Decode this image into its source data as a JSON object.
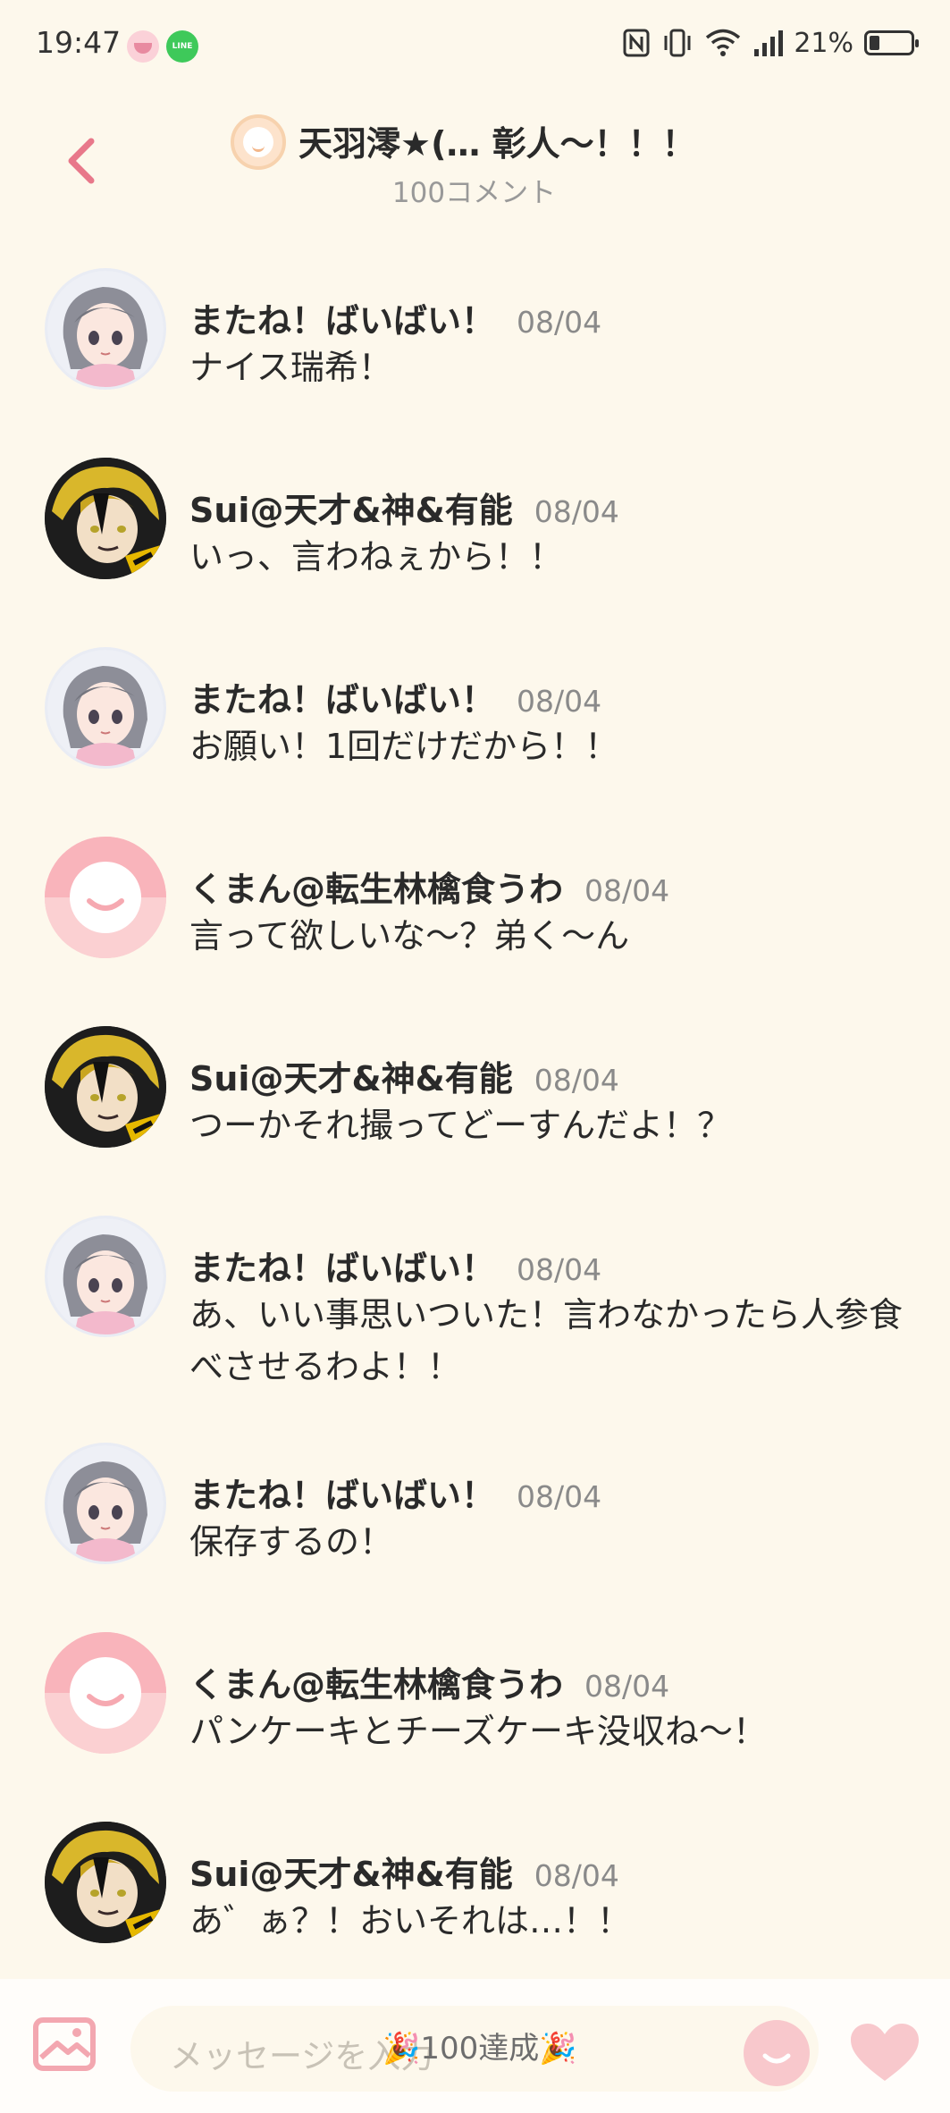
{
  "status": {
    "time": "19:47",
    "battery": "21%",
    "battery_level": 0.21
  },
  "header": {
    "title": "天羽澪★(…  彰人〜！！！",
    "comment_count": "100コメント"
  },
  "messages": [
    {
      "author": "またね！ばいばい！",
      "date": "08/04",
      "text": "ナイス瑞希！",
      "avatar": "girl"
    },
    {
      "author": "Sui@天才&神&有能",
      "date": "08/04",
      "text": "いっ、言わねぇから！！",
      "avatar": "boy"
    },
    {
      "author": "またね！ばいばい！",
      "date": "08/04",
      "text": "お願い！1回だけだから！！",
      "avatar": "girl"
    },
    {
      "author": "くまん@転生林檎食うわ",
      "date": "08/04",
      "text": "言って欲しいな〜？弟く〜ん",
      "avatar": "default"
    },
    {
      "author": "Sui@天才&神&有能",
      "date": "08/04",
      "text": "つーかそれ撮ってどーすんだよ！？",
      "avatar": "boy"
    },
    {
      "author": "またね！ばいばい！",
      "date": "08/04",
      "text": "あ、いい事思いついた！言わなかったら人参食べさせるわよ！！",
      "avatar": "girl"
    },
    {
      "author": "またね！ばいばい！",
      "date": "08/04",
      "text": "保存するの！",
      "avatar": "girl"
    },
    {
      "author": "くまん@転生林檎食うわ",
      "date": "08/04",
      "text": "パンケーキとチーズケーキ没収ね〜！",
      "avatar": "default"
    },
    {
      "author": "Sui@天才&神&有能",
      "date": "08/04",
      "text": "あ゛ぁ？！おいそれは…！！",
      "avatar": "boy"
    }
  ],
  "composer": {
    "placeholder": "メッセージを入力",
    "achievement": "🎉100達成🎉"
  },
  "colors": {
    "background": "#fdf8ec",
    "accent_pink": "#e8788a"
  },
  "icons": [
    "back-chevron-icon",
    "image-icon",
    "smile-icon",
    "heart-icon",
    "nfc-icon",
    "vibrate-icon",
    "wifi-icon",
    "signal-icon",
    "battery-icon"
  ]
}
